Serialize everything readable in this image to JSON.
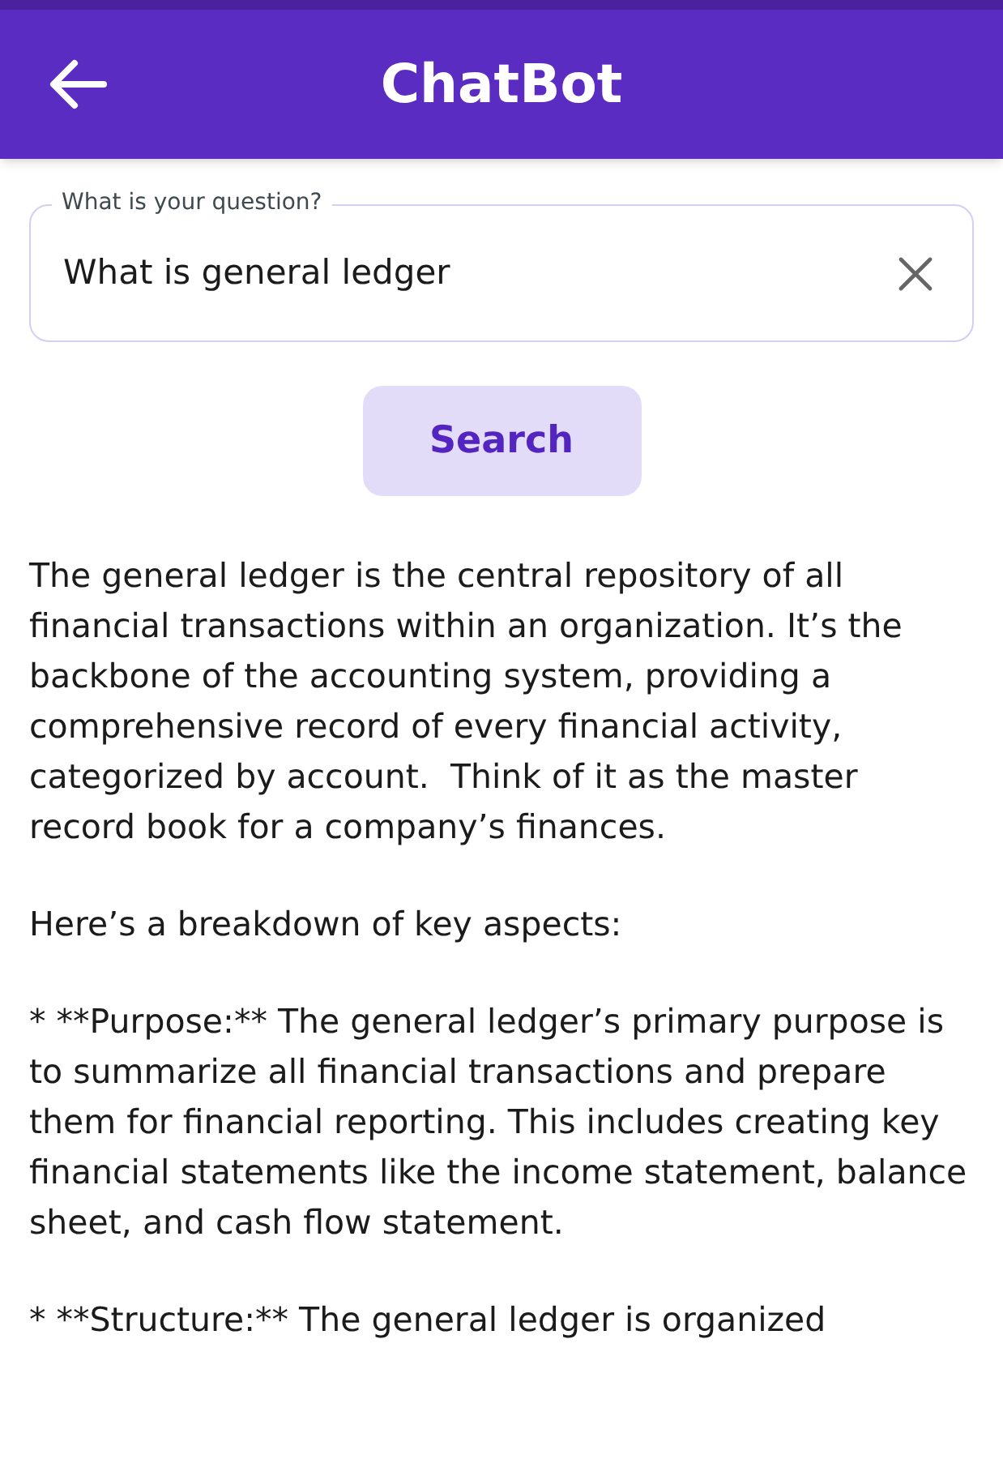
{
  "app_bar": {
    "title": "ChatBot"
  },
  "question_field": {
    "label": "What is your question?",
    "value": "What is general ledger"
  },
  "search_button": {
    "label": "Search"
  },
  "answer": [
    "The general ledger is the central repository of all financial transactions within an organization. It’s the backbone of the accounting system, providing a comprehensive record of every financial activity, categorized by account.  Think of it as the master record book for a company’s finances.",
    "Here’s a breakdown of key aspects:",
    "* **Purpose:** The general ledger’s primary purpose is to summarize all financial transactions and prepare them for financial reporting. This includes creating key financial statements like the income statement, balance sheet, and cash flow statement.",
    "* **Structure:** The general ledger is organized"
  ]
}
